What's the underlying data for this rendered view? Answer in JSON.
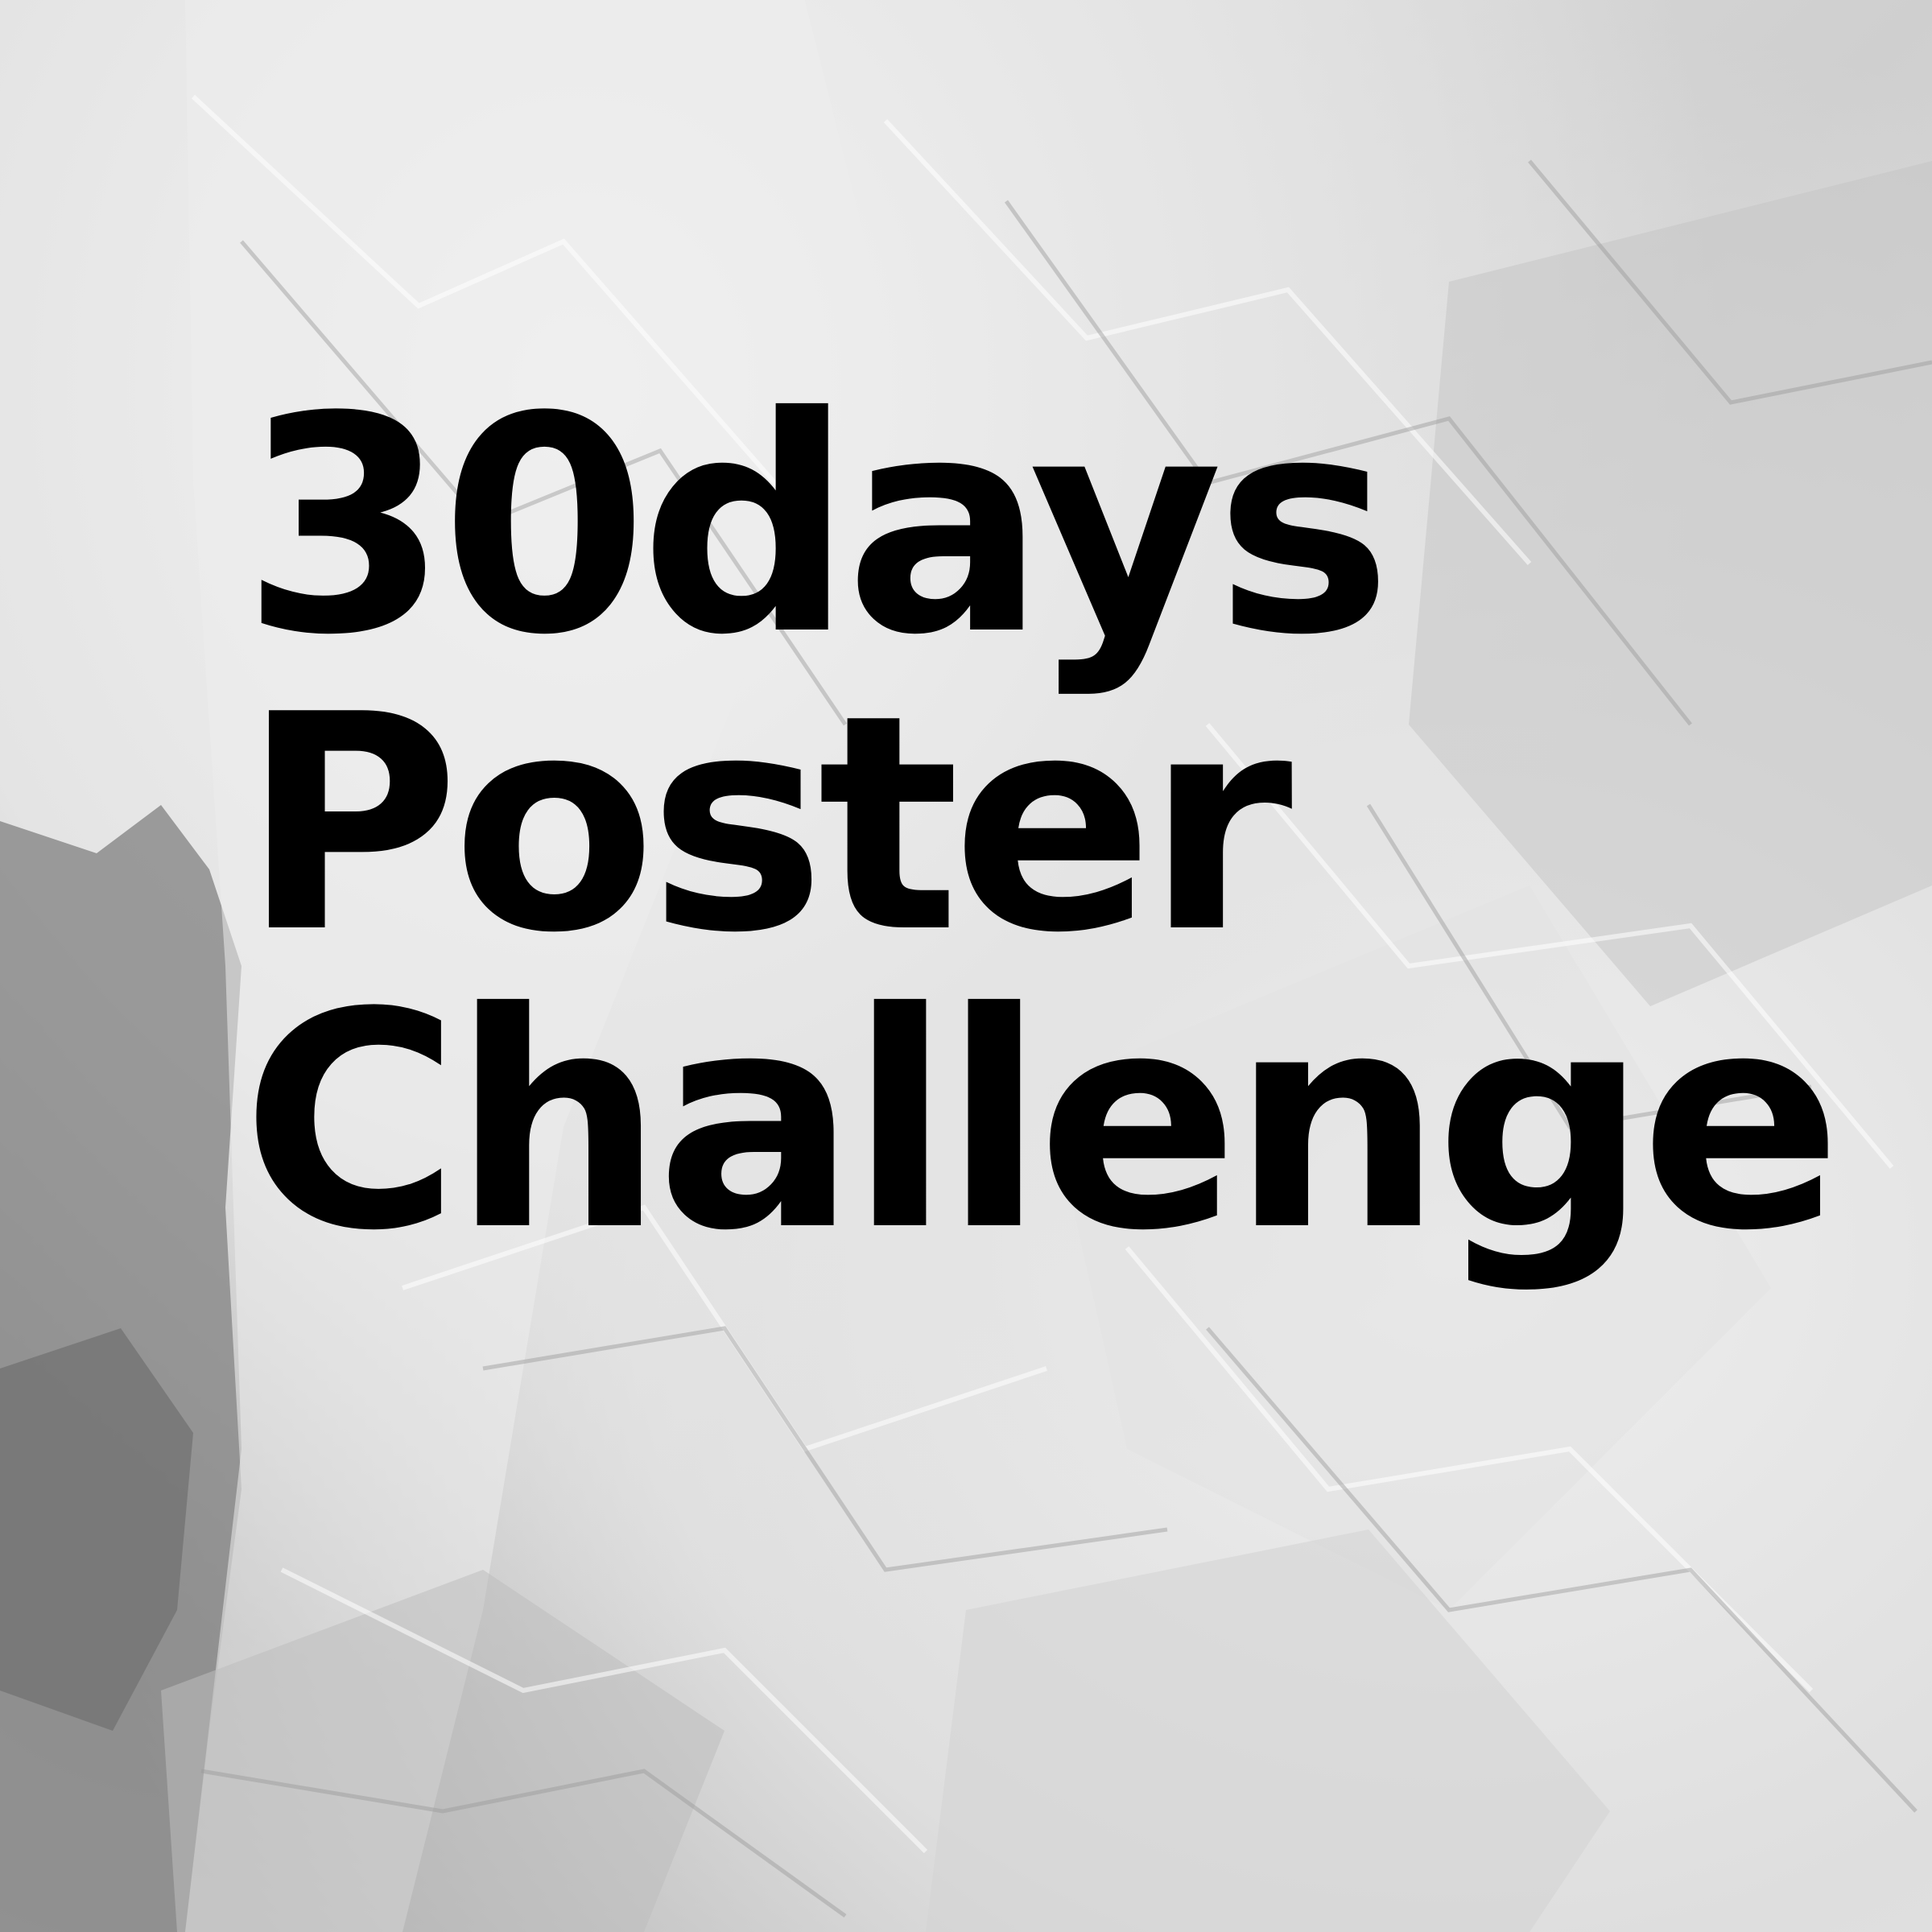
{
  "poster": {
    "title_lines": [
      "30days",
      "Poster",
      "Challenge"
    ]
  },
  "colors": {
    "text": "#000000",
    "paper_light": "#f0f0f0",
    "paper_mid": "#cfcfcf",
    "paper_dark": "#7a7a7a"
  }
}
